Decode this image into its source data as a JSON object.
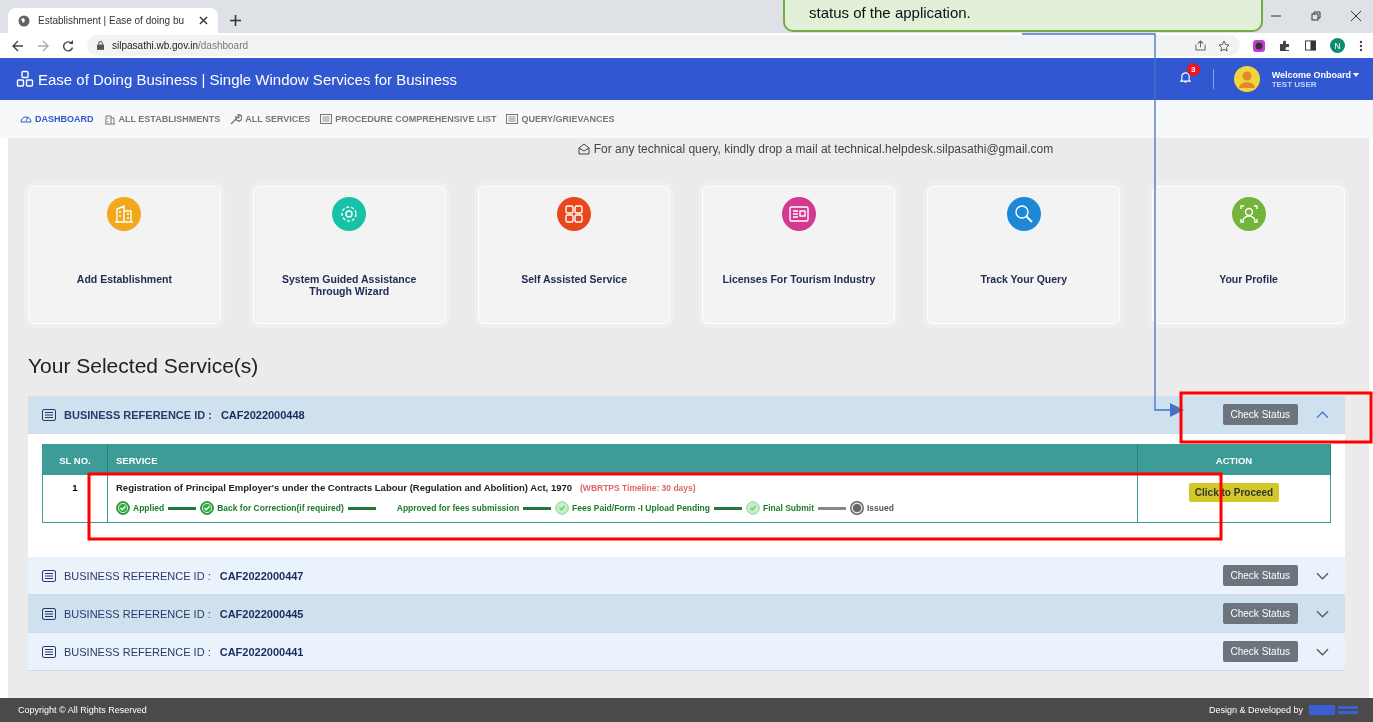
{
  "browser": {
    "tab_title": "Establishment | Ease of doing bu",
    "url_host": "silpasathi.wb.gov.in",
    "url_path": "/dashboard",
    "profile_initial": "N"
  },
  "header": {
    "title": "Ease of Doing Business | Single Window Services for Business",
    "notification_count": "3",
    "welcome": "Welcome Onboard",
    "user": "TEST USER"
  },
  "nav": [
    {
      "label": "DASHBOARD",
      "kind": "gauge",
      "selected": true
    },
    {
      "label": "ALL ESTABLISHMENTS",
      "kind": "building",
      "selected": false
    },
    {
      "label": "ALL SERVICES",
      "kind": "wrench",
      "selected": false
    },
    {
      "label": "PROCEDURE COMPREHENSIVE LIST",
      "kind": "list",
      "selected": false
    },
    {
      "label": "QUERY/GRIEVANCES",
      "kind": "list",
      "selected": false
    }
  ],
  "notice": "For any technical query, kindly drop a mail at technical.helpdesk.silpasathi@gmail.com",
  "cards": [
    {
      "label": "Add Establishment",
      "kind": "building",
      "color": "#f2a81d"
    },
    {
      "label": "System Guided Assistance Through Wizard",
      "kind": "gear",
      "color": "#17c3a8"
    },
    {
      "label": "Self Assisted Service",
      "kind": "grid",
      "color": "#e8471c"
    },
    {
      "label": "Licenses For Tourism Industry",
      "kind": "card",
      "color": "#d2398f"
    },
    {
      "label": "Track Your Query",
      "kind": "search",
      "color": "#1e88d6"
    },
    {
      "label": "Your Profile",
      "kind": "profile",
      "color": "#72b53a"
    }
  ],
  "section_title": "Your Selected Service(s)",
  "services": [
    {
      "label": "BUSINESS REFERENCE ID :",
      "ref": "CAF2022000448",
      "button": "Check Status",
      "expanded": true,
      "table": {
        "columns": [
          "SL NO.",
          "SERVICE",
          "ACTION"
        ],
        "rows": [
          {
            "sl": "1",
            "service": "Registration of Principal Employer's under the Contracts Labour (Regulation and Abolition) Act, 1970",
            "timeline": "(WBRTPS Timeline: 30 days)",
            "action": "Click to Proceed",
            "steps": [
              {
                "label": "Applied",
                "kind": "done"
              },
              {
                "label": "Back for Correction(if required)",
                "kind": "done"
              },
              {
                "label": "Approved for fees submission",
                "kind": "blank"
              },
              {
                "label": "Fees Paid/Form -I Upload Pending",
                "kind": "faint"
              },
              {
                "label": "Final Submit",
                "kind": "faint"
              },
              {
                "label": "Issued",
                "kind": "issued"
              }
            ]
          }
        ]
      }
    },
    {
      "label": "BUSINESS REFERENCE ID :",
      "ref": "CAF2022000447",
      "button": "Check Status",
      "expanded": false
    },
    {
      "label": "BUSINESS REFERENCE ID :",
      "ref": "CAF2022000445",
      "button": "Check Status",
      "expanded": false
    },
    {
      "label": "BUSINESS REFERENCE ID :",
      "ref": "CAF2022000441",
      "button": "Check Status",
      "expanded": false
    }
  ],
  "footer": {
    "copyright": "Copyright © All Rights Reserved",
    "credit": "Design & Developed by"
  },
  "callout": {
    "text": "status of the application."
  }
}
